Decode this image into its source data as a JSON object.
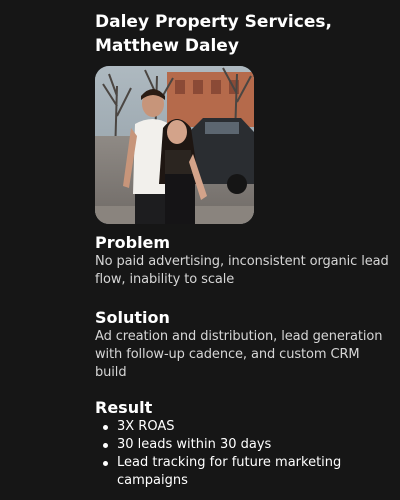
{
  "header": {
    "title_line1": "Daley Property Services,",
    "title_line2": "Matthew Daley"
  },
  "photo": {
    "icon": "couple-photo"
  },
  "problem": {
    "heading": "Problem",
    "body": "No paid advertising, inconsistent organic lead flow, inability to scale"
  },
  "solution": {
    "heading": "Solution",
    "body": "Ad creation and distribution, lead generation with follow-up cadence, and custom CRM build"
  },
  "result": {
    "heading": "Result",
    "items": [
      "3X ROAS",
      "30 leads within 30 days",
      "Lead tracking for future marketing campaigns"
    ]
  },
  "colors": {
    "background": "#161616",
    "text": "#ffffff",
    "muted_text": "#d6d6d6"
  }
}
